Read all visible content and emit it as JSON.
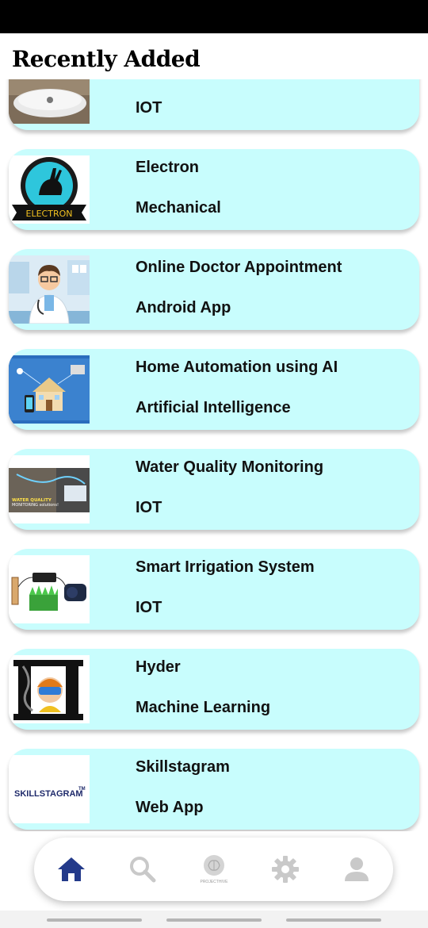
{
  "header": {
    "title": "Recently Added"
  },
  "projects": [
    {
      "title": "",
      "category": "IOT",
      "thumb": "robot-vacuum"
    },
    {
      "title": "Electron",
      "category": "Mechanical",
      "thumb": "electron-logo"
    },
    {
      "title": "Online Doctor Appointment",
      "category": "Android App",
      "thumb": "doctor"
    },
    {
      "title": "Home Automation using AI",
      "category": "Artificial Intelligence",
      "thumb": "smart-home"
    },
    {
      "title": "Water Quality Monitoring",
      "category": "IOT",
      "thumb": "water-quality"
    },
    {
      "title": "Smart Irrigation System",
      "category": "IOT",
      "thumb": "irrigation"
    },
    {
      "title": "Hyder",
      "category": "Machine Learning",
      "thumb": "hyder-logo"
    },
    {
      "title": "Skillstagram",
      "category": "Web App",
      "thumb": "skillstagram-logo"
    }
  ],
  "thumb_text": {
    "electron": "ELECTRON",
    "water_line1": "WATER QUALITY",
    "water_line2": "MONITORING solutions!",
    "skillstagram": "SKILLSTAGRAM",
    "tm": "TM"
  },
  "nav": {
    "items": [
      {
        "name": "home",
        "icon": "home-icon",
        "active": true
      },
      {
        "name": "search",
        "icon": "search-icon",
        "active": false
      },
      {
        "name": "projects",
        "icon": "brain-icon",
        "active": false,
        "caption": "PROJECTHIVE"
      },
      {
        "name": "settings",
        "icon": "gear-icon",
        "active": false
      },
      {
        "name": "profile",
        "icon": "user-icon",
        "active": false
      }
    ],
    "active_color": "#233a8a",
    "inactive_color": "#c9c9c9"
  },
  "colors": {
    "card_bg": "#c8fdfd",
    "status_bar": "#000000"
  }
}
